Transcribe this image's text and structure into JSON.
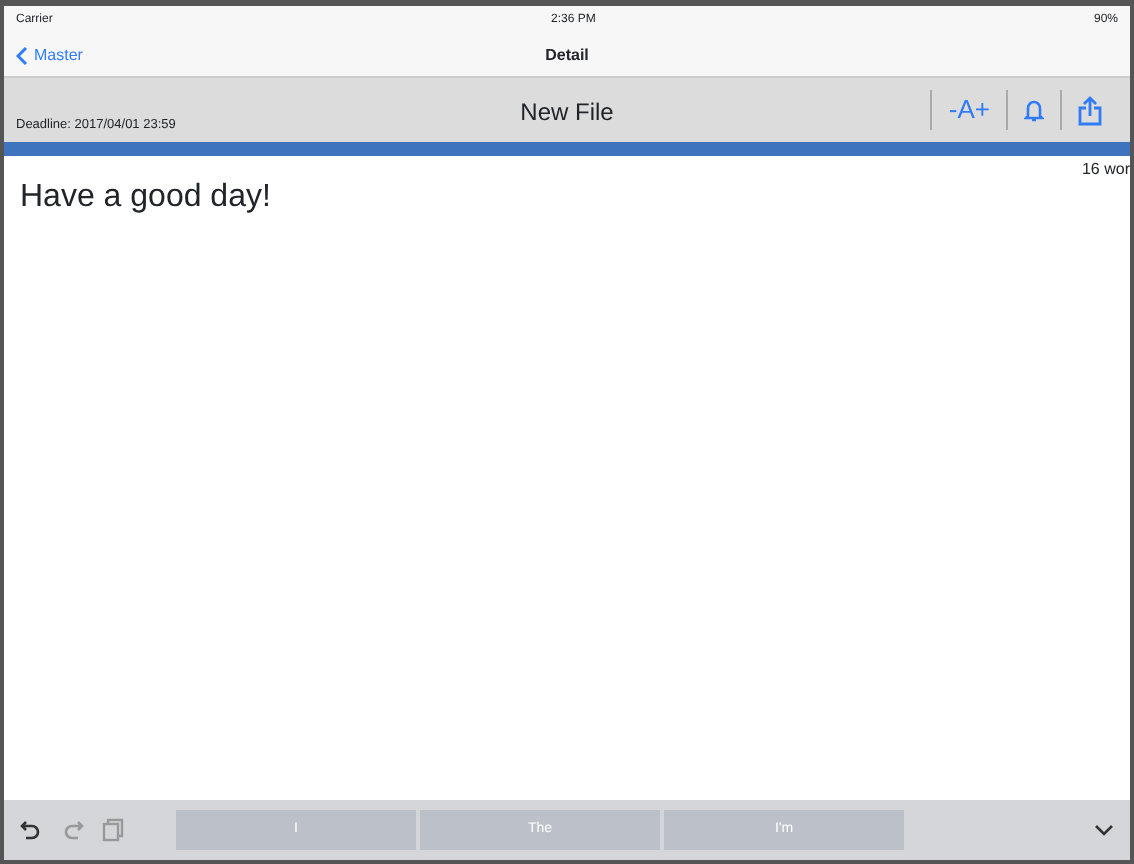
{
  "status_bar": {
    "carrier": "Carrier",
    "time": "2:36 PM",
    "battery": "90%"
  },
  "nav": {
    "back": "Master",
    "title": "Detail"
  },
  "toolbar": {
    "deadline": "Deadline: 2017/04/01 23:59",
    "file_title": "New File",
    "font_size": "-A+"
  },
  "editor": {
    "word_count": "16 wor",
    "text": "Have a good day!"
  },
  "suggestions": [
    "I",
    "The",
    "I'm"
  ]
}
